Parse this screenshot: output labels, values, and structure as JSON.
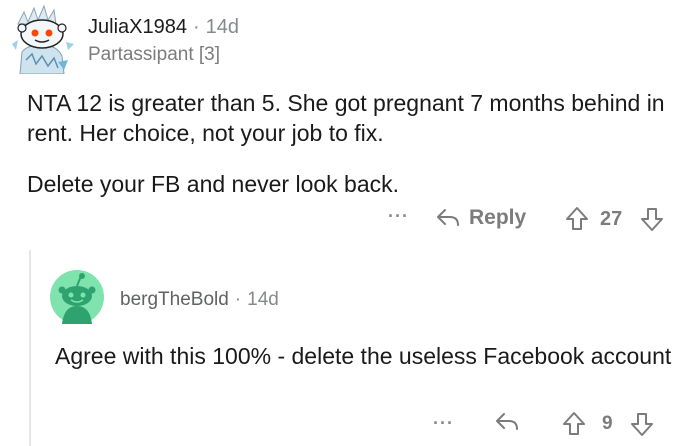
{
  "comments": [
    {
      "username": "JuliaX1984",
      "separator": "·",
      "age": "14d",
      "flair": "Partassipant [3]",
      "paragraphs": [
        "NTA 12 is greater than 5. She got pregnant 7 months behind in rent. Her choice, not your job to fix.",
        "Delete your FB and never look back."
      ],
      "actions": {
        "more": "···",
        "reply": "Reply",
        "score": "27"
      }
    },
    {
      "username": "bergTheBold",
      "separator": "·",
      "age": "14d",
      "paragraphs": [
        "Agree with this 100% - delete the useless Facebook account"
      ],
      "actions": {
        "more": "···",
        "score": "9"
      }
    }
  ],
  "colors": {
    "text": "#1a1a1b",
    "meta": "#878a8c",
    "avatar2_bg": "#7fe3ad"
  },
  "icons": [
    "snoo-avatar-icon",
    "reply-arrow-icon",
    "upvote-icon",
    "downvote-icon",
    "more-options-icon"
  ]
}
